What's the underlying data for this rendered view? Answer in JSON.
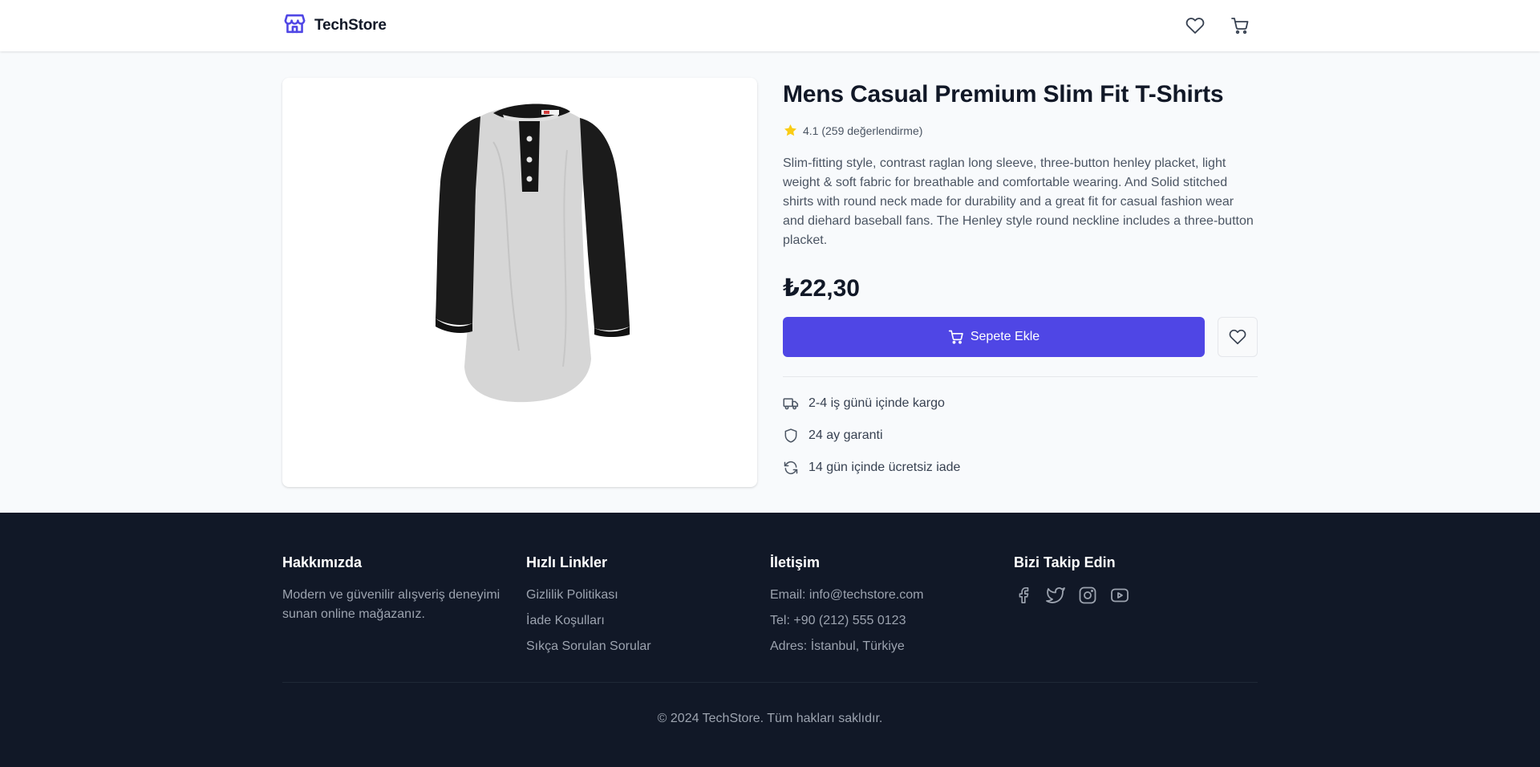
{
  "header": {
    "brand": "TechStore",
    "icons": [
      "store-icon",
      "heart-icon",
      "cart-icon"
    ]
  },
  "product": {
    "title": "Mens Casual Premium Slim Fit T-Shirts",
    "rating_value": 4.1,
    "rating_text": "4.1 (259 değerlendirme)",
    "description": "Slim-fitting style, contrast raglan long sleeve, three-button henley placket, light weight & soft fabric for breathable and comfortable wearing. And Solid stitched shirts with round neck made for durability and a great fit for casual fashion wear and diehard baseball fans. The Henley style round neckline includes a three-button placket.",
    "price": "₺22,30",
    "add_to_cart_label": "Sepete Ekle",
    "features": [
      {
        "icon": "truck-icon",
        "label": "2-4 iş günü içinde kargo"
      },
      {
        "icon": "shield-icon",
        "label": "24 ay garanti"
      },
      {
        "icon": "refresh-icon",
        "label": "14 gün içinde ücretsiz iade"
      }
    ]
  },
  "footer": {
    "about": {
      "title": "Hakkımızda",
      "text": "Modern ve güvenilir alışveriş deneyimi sunan online mağazanız."
    },
    "links": {
      "title": "Hızlı Linkler",
      "items": [
        "Gizlilik Politikası",
        "İade Koşulları",
        "Sıkça Sorulan Sorular"
      ]
    },
    "contact": {
      "title": "İletişim",
      "items": [
        "Email: info@techstore.com",
        "Tel: +90 (212) 555 0123",
        "Adres: İstanbul, Türkiye"
      ]
    },
    "social": {
      "title": "Bizi Takip Edin",
      "icons": [
        "facebook-icon",
        "twitter-icon",
        "instagram-icon",
        "youtube-icon"
      ]
    },
    "copyright": "© 2024 TechStore. Tüm hakları saklıdır."
  },
  "colors": {
    "accent": "#4f46e5",
    "footer_bg": "#111827",
    "star": "#facc15",
    "page_bg": "#f8fafc"
  }
}
